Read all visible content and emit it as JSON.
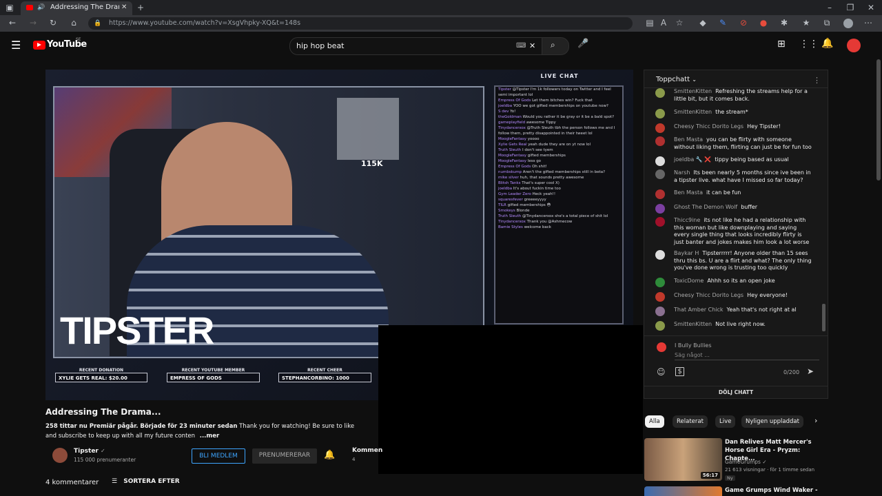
{
  "browser": {
    "tab_title": "Addressing The Drama...",
    "url": "https://www.youtube.com/watch?v=XsgVhpky-XQ&t=148s",
    "new_tab_icon": "plus-icon"
  },
  "youtube": {
    "logo_text": "YouTube",
    "region": "SE",
    "search_value": "hip hop beat"
  },
  "stream_overlay": {
    "live_chat_header": "LIVE CHAT",
    "streamer_logo": "TIPSTER",
    "poster_text": "115K",
    "stats": [
      {
        "title": "RECENT DONATION",
        "value": "XYLIE GETS REAL: $20.00"
      },
      {
        "title": "RECENT YOUTUBE MEMBER",
        "value": "EMPRESS OF GODS"
      },
      {
        "title": "RECENT CHEER",
        "value": "STEPHANCORBINO: 1000"
      }
    ],
    "chat_lines": [
      {
        "name": "Tipster",
        "text": "@Tipster I'm 1k followers today on Twitter and I feel semi important lol"
      },
      {
        "name": "Empress Of Gods",
        "text": "Let them bitches win? Fuck that"
      },
      {
        "name": "joeldba",
        "text": "YOO we got gifted memberships on youtube now?"
      },
      {
        "name": "S dev",
        "text": "Yo!"
      },
      {
        "name": "theGoldman",
        "text": "Would you rather it be gray or it be a bald spot?"
      },
      {
        "name": "gameplayfield",
        "text": "awesome Tippy"
      },
      {
        "name": "Tinydancerxox",
        "text": "@Truth Sleuth tbh the person follows me and I follow them, pretty disappointed in their tweet lol"
      },
      {
        "name": "MoogleFantasy",
        "text": "yoooo"
      },
      {
        "name": "Xylie Gets Real",
        "text": "yeah dude they are on yt now lol"
      },
      {
        "name": "Truth Sleuth",
        "text": "I don't see tyem"
      },
      {
        "name": "MoogleFantasy",
        "text": "gifted memberships"
      },
      {
        "name": "MoogleFantasy",
        "text": "less go"
      },
      {
        "name": "Empress Of Gods",
        "text": "Oh shit!"
      },
      {
        "name": "numbskump",
        "text": "Aren't the gifted memberships still in beta?"
      },
      {
        "name": "mike silver",
        "text": "huh, that sounds pretty awesome"
      },
      {
        "name": "Blitsh Tanks",
        "text": "That's super cool X)"
      },
      {
        "name": "joeldba",
        "text": "It's about fuckin time too"
      },
      {
        "name": "Gym Leader Zero",
        "text": "Heck yeah!!"
      },
      {
        "name": "squaresfever",
        "text": "greeeeyyyy"
      },
      {
        "name": "TILR",
        "text": "gifted memberships 😳"
      },
      {
        "name": "Smokeys",
        "text": "Blonde"
      },
      {
        "name": "Truth Sleuth",
        "text": "@Tinydancerxox she's a total piece of shit lol"
      },
      {
        "name": "Tinydancerxox",
        "text": "Thank you @Ashmecow"
      },
      {
        "name": "Bamie Styles",
        "text": "welcome back"
      }
    ]
  },
  "video": {
    "title": "Addressing The Drama...",
    "stats": "258 tittar nu  Premiär pågår. Började för 23 minuter sedan",
    "desc_line1": "Thank you for watching! Be sure to like",
    "desc_line2": "and subscribe to keep up with all my future conten",
    "more": "...mer",
    "channel_name": "Tipster",
    "subscribers": "115 000 prenumeranter",
    "join_button": "BLI MEDLEM",
    "subscribe_button": "PRENUMERERAR",
    "comments_label": "Kommen",
    "comments_count": "4",
    "comments_total": "4 kommentarer",
    "sort_label": "SORTERA EFTER"
  },
  "chat": {
    "mode": "Toppchatt",
    "messages": [
      {
        "author": "SmittenKitten",
        "text": "Refreshing the streams help for a little bit, but it comes back.",
        "color": "#8a9a4a"
      },
      {
        "author": "SmittenKitten",
        "text": "the stream*",
        "color": "#8a9a4a"
      },
      {
        "author": "Cheesy Thicc Dorito Legs",
        "text": "Hey Tipster!",
        "color": "#c0392b"
      },
      {
        "author": "Ben Masta",
        "text": "you can be flirty with someone without liking them, flirting can just be for fun too",
        "color": "#b03030"
      },
      {
        "author": "joeldba 🔧 ❌",
        "text": "tippy being based as usual",
        "color": "#dddddd"
      },
      {
        "author": "Narsh",
        "text": "Its been nearly 5 months since ive been in a tipster live. what have I missed so far today?",
        "color": "#666666"
      },
      {
        "author": "Ben Masta",
        "text": "it can be fun",
        "color": "#b03030"
      },
      {
        "author": "Ghost The Demon Wolf",
        "text": "buffer",
        "color": "#7b3fa0"
      },
      {
        "author": "Thicc9ine",
        "text": "its not like he had a relationship with this woman but like downplaying and saying every single thing that looks incredibly flirty is just banter and jokes makes him look a lot worse",
        "color": "#a0102a"
      },
      {
        "author": "Baykar H",
        "text": "Tipsterrrrr! Anyone older than 15 sees thru this bs. U are a flirt and what? The only thing you've done wrong is trusting too quickly",
        "color": "#dddddd"
      },
      {
        "author": "ToxicDome",
        "text": "Ahhh so its an open joke",
        "color": "#2e8b3a"
      },
      {
        "author": "Cheesy Thicc Dorito Legs",
        "text": "Hey everyone!",
        "color": "#c0392b"
      },
      {
        "author": "That Amber Chick",
        "text": "Yeah that's not right at al",
        "color": "#8a7090"
      },
      {
        "author": "SmittenKitten",
        "text": "Not live right now.",
        "color": "#8a9a4a"
      }
    ],
    "input_user": "I Bully Bullies",
    "input_placeholder": "Säg något ...",
    "char_count": "0/200",
    "hide_chat": "DÖLJ CHATT"
  },
  "chips": [
    "Alla",
    "Relaterat",
    "Live",
    "Nyligen uppladdat"
  ],
  "related": [
    {
      "title_line1": "Dan Relives Matt Mercer's",
      "title_line2": "Horse Girl Era - Pryzm: Chapte...",
      "channel": "GameGrumps",
      "meta": "21 613 visningar · för 1 timme sedan",
      "duration": "56:17",
      "badge": "Ny"
    },
    {
      "title_line1": "Game Grumps Wind Waker -"
    }
  ]
}
